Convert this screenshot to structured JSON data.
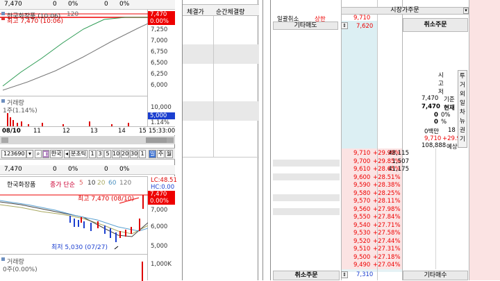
{
  "top_info": {
    "price": "7,470",
    "v1": "0",
    "p1": "0%",
    "v2": "0",
    "p2": "0%"
  },
  "mini_chart": {
    "title": "한국화장품 (10:06)",
    "title_suffix": "120",
    "high_label": "최고 7,470 (10:06)",
    "price_tag": "7,470",
    "pct_tag": "0.00%",
    "y_ticks": [
      "7,250",
      "7,000",
      "6,750",
      "6,500",
      "6,250",
      "6,000"
    ]
  },
  "volume": {
    "title": "거래량",
    "sub": "1주(1.14%)",
    "y_ticks": [
      "10,000",
      "5,000",
      "1.14%"
    ]
  },
  "x_axis": {
    "labels": [
      "08/10",
      "11",
      "12",
      "13",
      "14",
      "15"
    ],
    "time": "15:33:00"
  },
  "toolbar": {
    "code": "123690",
    "name": "한국",
    "sub": "분초틱",
    "nums": [
      "1",
      "3",
      "5",
      "10",
      "20",
      "30",
      "1"
    ],
    "d": "일",
    "w": "주",
    "m": "월"
  },
  "daily_info": {
    "price": "7,470",
    "v1": "0",
    "p1": "0%",
    "v2": "0",
    "p2": "0%"
  },
  "daily_chart": {
    "name": "한국화장품",
    "ma_label": "종가 단순",
    "ma": [
      "5",
      "10",
      "20",
      "60",
      "120"
    ],
    "lc": "LC:48.51",
    "hc": "HC:0.00",
    "price_tag": "7,470",
    "pct_tag": "0.00%",
    "high": "최고 7,470 (08/10)",
    "low": "최저 5,030 (07/27)",
    "y_ticks": [
      "7,000",
      "6,000",
      "5,000"
    ]
  },
  "daily_volume": {
    "title": "거래량",
    "sub": "0주(0.00%)",
    "y_tick": "1,000K"
  },
  "trades": {
    "col1": "체결가",
    "col2": "순간체결량"
  },
  "order": {
    "cancel_all": "일괄취소",
    "upper": "상한",
    "upper_price": "9,710",
    "other_sell": "기타매도",
    "other_sell_price": "7,620",
    "title": "시장가주문",
    "cancel_label": "취소주문",
    "stat_labels": [
      "시",
      "고",
      "저"
    ],
    "base_price": "7,470",
    "base_label": "기준",
    "cur_price": "7,470",
    "cur_label": "현재",
    "zero1": "0",
    "pct1": "0%",
    "pct2": "%",
    "zero2": "0",
    "vol_label": "0백만",
    "vol_num": "18",
    "exp_price": "9,710",
    "exp_pct": "+29.99",
    "exp_qty": "108,888",
    "exp_label": "예상",
    "side_labels": [
      "투",
      "거",
      "외",
      "일",
      "차",
      "뉴",
      "권",
      "기"
    ],
    "ladder": [
      {
        "price": "9,710",
        "pct": "+29.99%",
        "qty": "48,115"
      },
      {
        "price": "9,700",
        "pct": "+29.85%",
        "qty": "1,507"
      },
      {
        "price": "9,610",
        "pct": "+28.65%",
        "qty": "41,175"
      },
      {
        "price": "9,600",
        "pct": "+28.51%",
        "qty": ""
      },
      {
        "price": "9,590",
        "pct": "+28.38%",
        "qty": ""
      },
      {
        "price": "9,580",
        "pct": "+28.25%",
        "qty": ""
      },
      {
        "price": "9,570",
        "pct": "+28.11%",
        "qty": ""
      },
      {
        "price": "9,560",
        "pct": "+27.98%",
        "qty": ""
      },
      {
        "price": "9,550",
        "pct": "+27.84%",
        "qty": ""
      },
      {
        "price": "9,540",
        "pct": "+27.71%",
        "qty": ""
      },
      {
        "price": "9,530",
        "pct": "+27.58%",
        "qty": ""
      },
      {
        "price": "9,520",
        "pct": "+27.44%",
        "qty": ""
      },
      {
        "price": "9,510",
        "pct": "+27.31%",
        "qty": ""
      },
      {
        "price": "9,500",
        "pct": "+27.18%",
        "qty": ""
      },
      {
        "price": "9,490",
        "pct": "+27.04%",
        "qty": ""
      }
    ],
    "bottom_cancel": "취소주문",
    "bottom_price": "7,310",
    "other_buy": "기타매수"
  },
  "colors": {
    "up": "#e00000",
    "down": "#0040c0",
    "accent_red": "#ff0000",
    "bid_pink": "#fbe3e3",
    "ask_blue": "#dceff3"
  }
}
